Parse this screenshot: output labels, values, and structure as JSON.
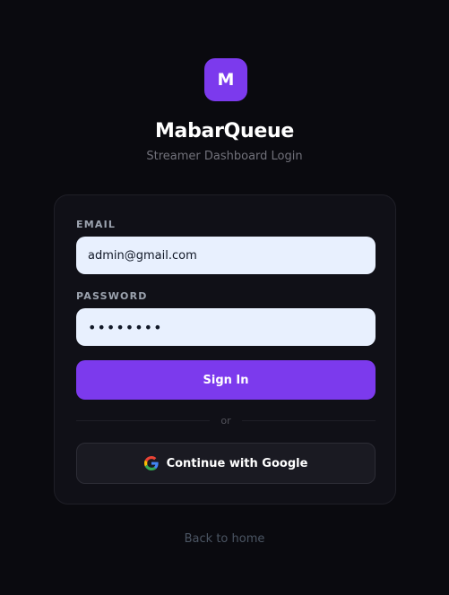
{
  "logo": {
    "letter": "M"
  },
  "header": {
    "title": "MabarQueue",
    "subtitle": "Streamer Dashboard Login"
  },
  "form": {
    "email": {
      "label": "EMAIL",
      "value": "admin@gmail.com"
    },
    "password": {
      "label": "PASSWORD",
      "value": "••••••••"
    },
    "sign_in_label": "Sign In",
    "divider_label": "or",
    "google_label": "Continue with Google"
  },
  "footer": {
    "back_link": "Back to home"
  },
  "colors": {
    "background": "#0a0a0f",
    "card": "#101017",
    "accent": "#7c3aed",
    "input_bg": "#e8f0fe"
  },
  "icons": {
    "google": "google-icon"
  }
}
